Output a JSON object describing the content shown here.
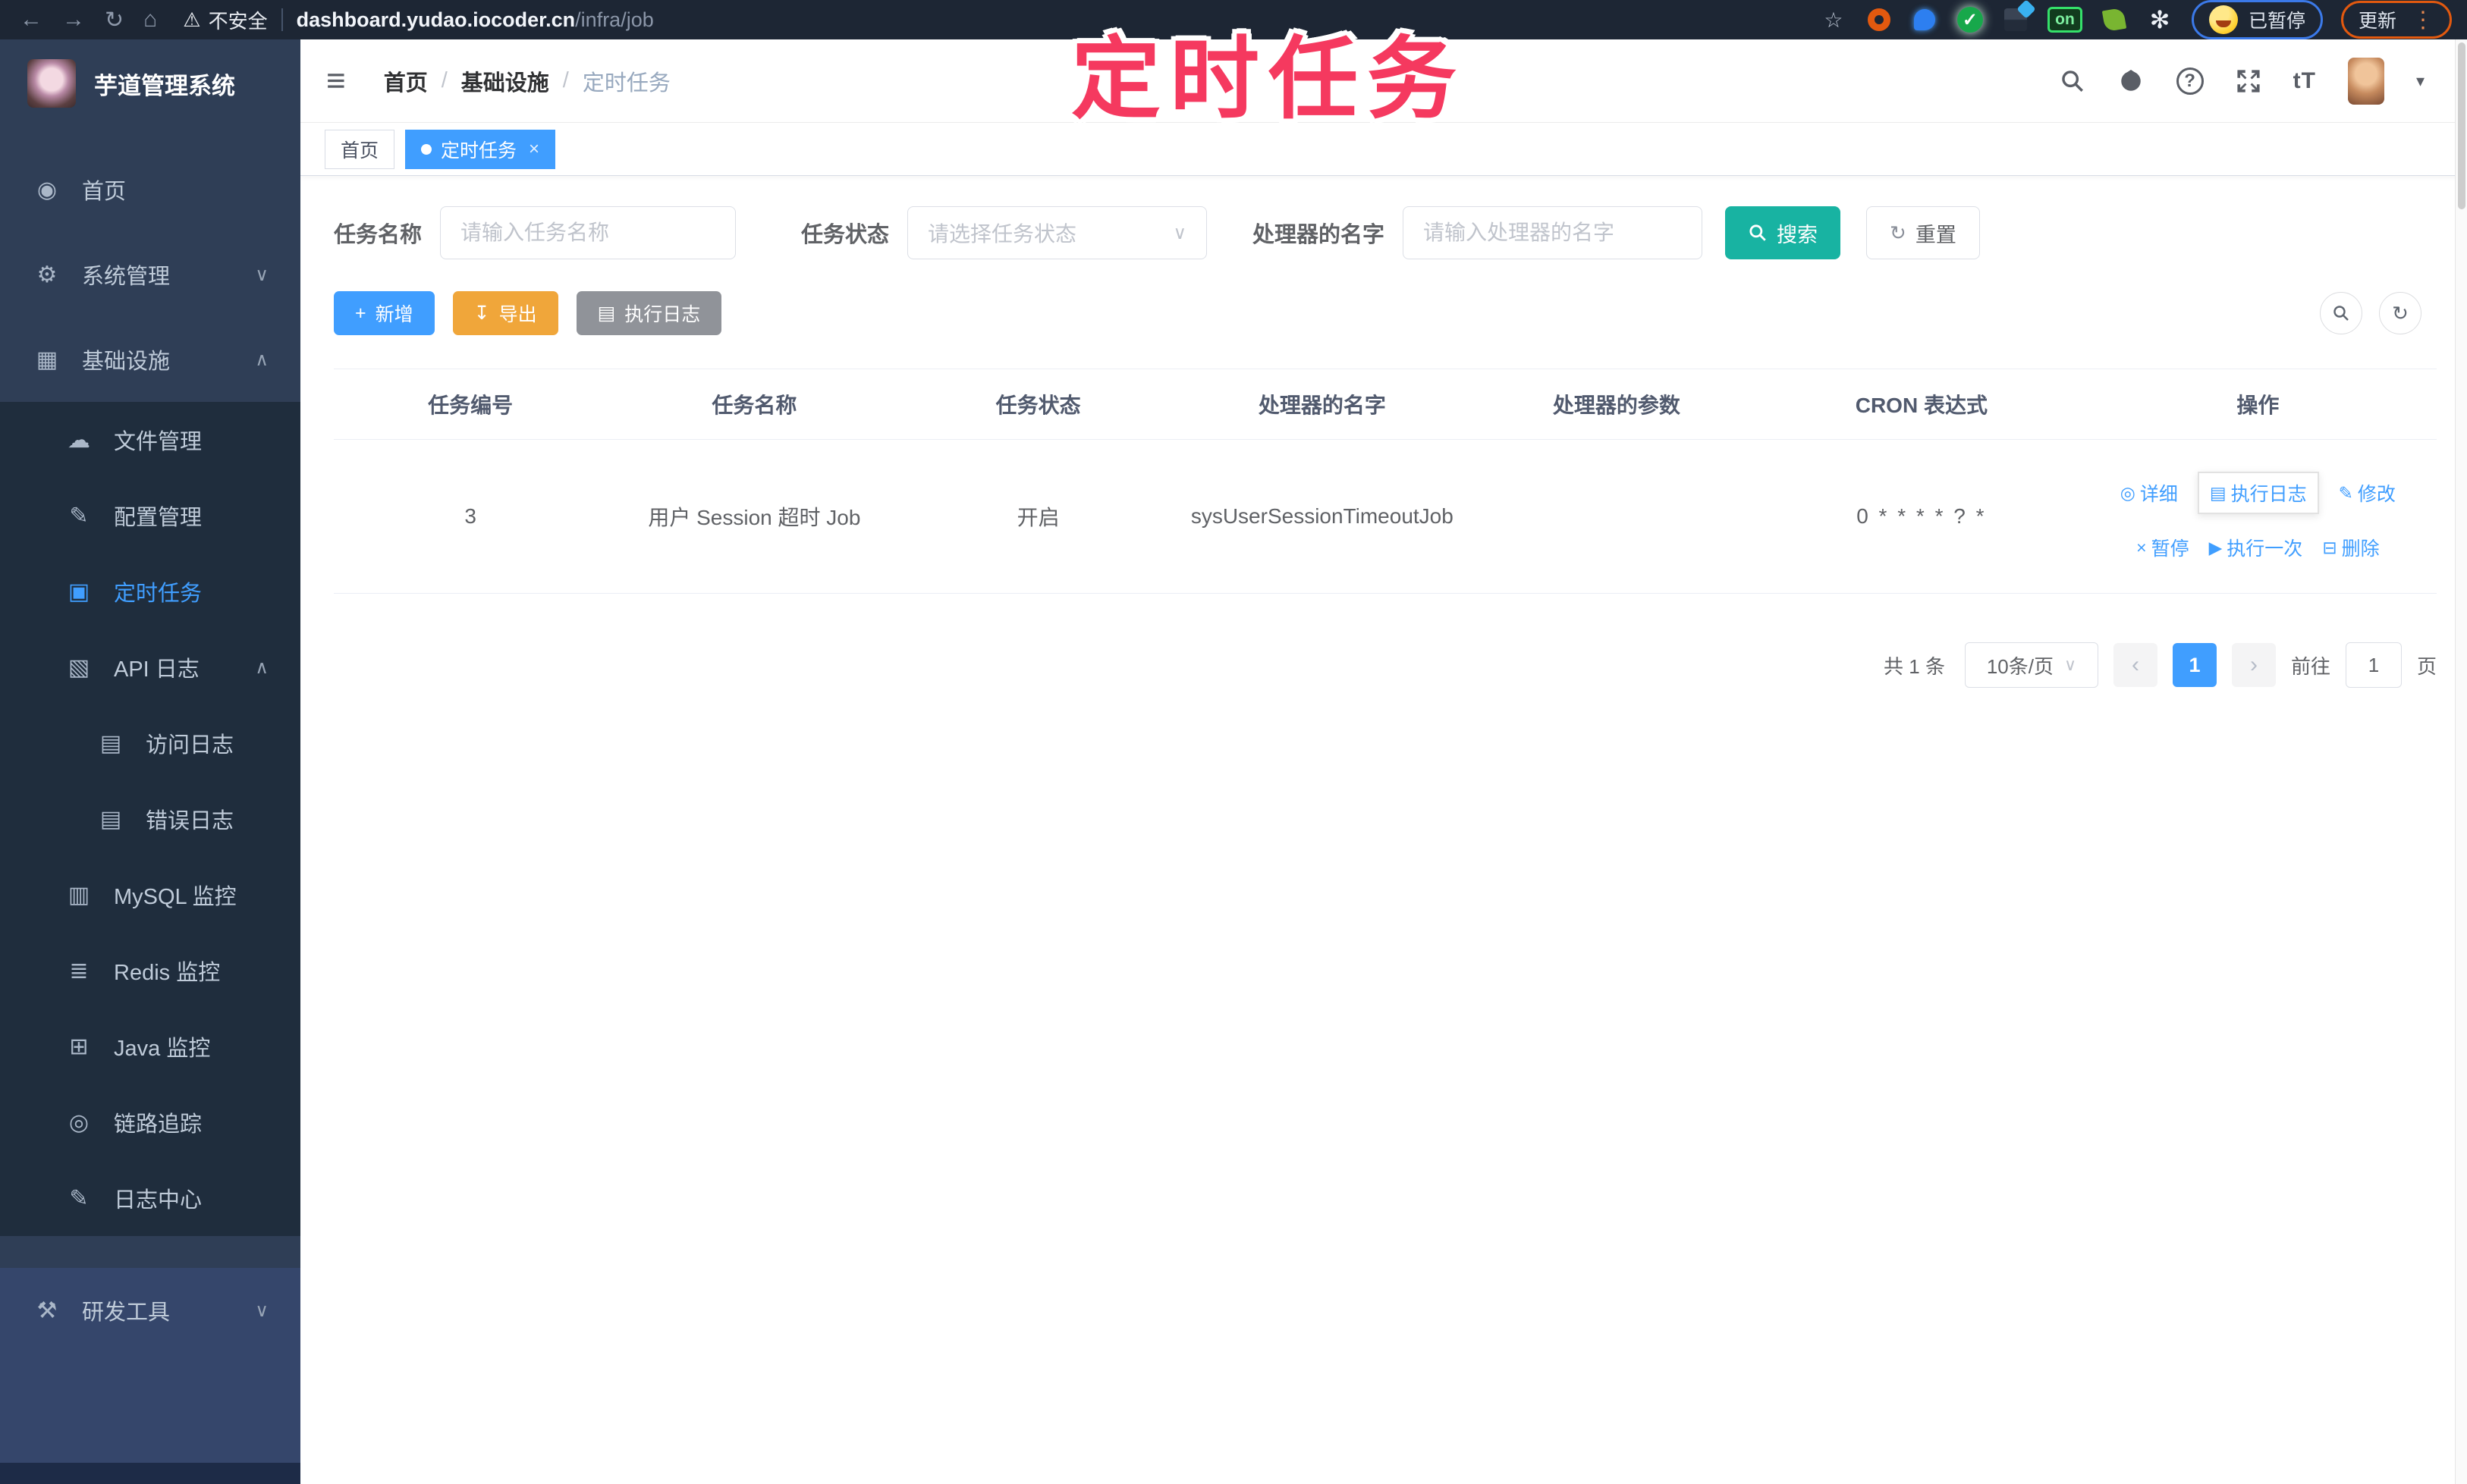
{
  "colors": {
    "accent": "#409EFF",
    "search_teal": "#18B3A2",
    "export_orange": "#F0A63A",
    "info_grey": "#909399",
    "annotation_pink": "#F5395F",
    "sidebar_bg": "#2F3E56",
    "submenu_bg": "#1F2D3D"
  },
  "browser": {
    "security_label": "不安全",
    "url_host": "dashboard.yudao.iocoder.cn",
    "url_path": "/infra/job",
    "on_badge": "on",
    "paused_label": "已暂停",
    "update_label": "更新"
  },
  "annotation": {
    "text": "定时任务"
  },
  "sidebar": {
    "logo_title": "芋道管理系统",
    "items": [
      {
        "icon": "dashboard-icon",
        "label": "首页"
      },
      {
        "icon": "gear-icon",
        "label": "系统管理"
      },
      {
        "icon": "infra-icon",
        "label": "基础设施"
      },
      {
        "icon": "cloud-icon",
        "label": "文件管理"
      },
      {
        "icon": "edit-icon",
        "label": "配置管理"
      },
      {
        "icon": "schedule-icon",
        "label": "定时任务"
      },
      {
        "icon": "api-log-icon",
        "label": "API 日志"
      },
      {
        "icon": "doc-icon",
        "label": "访问日志"
      },
      {
        "icon": "doc-icon",
        "label": "错误日志"
      },
      {
        "icon": "database-icon",
        "label": "MySQL 监控"
      },
      {
        "icon": "layers-icon",
        "label": "Redis 监控"
      },
      {
        "icon": "monitor-icon",
        "label": "Java 监控"
      },
      {
        "icon": "trace-icon",
        "label": "链路追踪"
      },
      {
        "icon": "pen-icon",
        "label": "日志中心"
      },
      {
        "icon": "tools-icon",
        "label": "研发工具"
      }
    ]
  },
  "header": {
    "breadcrumb": [
      "首页",
      "基础设施",
      "定时任务"
    ]
  },
  "tabs": [
    {
      "label": "首页"
    },
    {
      "label": "定时任务"
    }
  ],
  "filters": {
    "job_name_label": "任务名称",
    "job_name_placeholder": "请输入任务名称",
    "job_status_label": "任务状态",
    "job_status_placeholder": "请选择任务状态",
    "handler_label": "处理器的名字",
    "handler_placeholder": "请输入处理器的名字",
    "search_label": "搜索",
    "reset_label": "重置"
  },
  "toolbar": {
    "add_label": "新增",
    "export_label": "导出",
    "exec_log_label": "执行日志"
  },
  "table": {
    "headers": [
      "任务编号",
      "任务名称",
      "任务状态",
      "处理器的名字",
      "处理器的参数",
      "CRON 表达式",
      "操作"
    ],
    "rows": [
      {
        "id": "3",
        "name": "用户 Session 超时 Job",
        "status": "开启",
        "handler": "sysUserSessionTimeoutJob",
        "param": "",
        "cron": "0 * * * * ? *"
      }
    ],
    "actions_row1": [
      {
        "label": "详细"
      },
      {
        "label": "执行日志"
      },
      {
        "label": "修改"
      }
    ],
    "actions_row2": [
      {
        "label": "暂停"
      },
      {
        "label": "执行一次"
      },
      {
        "label": "删除"
      }
    ]
  },
  "pagination": {
    "total": "共 1 条",
    "page_size": "10条/页",
    "current_page": "1",
    "goto_label": "前往",
    "goto_value": "1",
    "page_unit": "页"
  },
  "icons": {
    "back": "←",
    "forward": "→",
    "reload": "↻",
    "home": "⌂",
    "warning": "⚠",
    "hamburger": "≡",
    "star": "☆",
    "flower": "✻",
    "kebab": "⋮",
    "dashboard": "◉",
    "gear": "⚙",
    "infra": "▦",
    "cloud": "☁",
    "edit": "✎",
    "schedule": "▣",
    "api": "▧",
    "doc": "▤",
    "db": "▥",
    "layers": "≣",
    "monitor": "⊞",
    "eye": "◎",
    "pen": "✎",
    "tools": "⚒",
    "chevron_down": "∨",
    "chevron_up": "∧",
    "caret_down": "▾",
    "dot": "●",
    "close": "×",
    "plus": "+",
    "download": "↧",
    "list": "▤",
    "play": "▶",
    "pause_x": "×",
    "del": "⊟",
    "refresh": "↻",
    "question": "?",
    "font_size": "tT",
    "check": "✓",
    "prev": "‹",
    "next": "›"
  }
}
